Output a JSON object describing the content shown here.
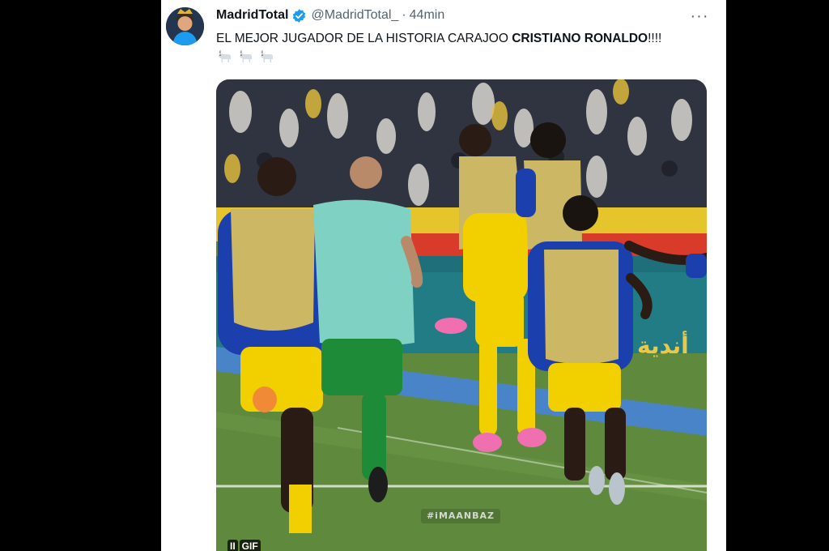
{
  "tweet": {
    "display_name": "MadridTotal",
    "handle": "@MadridTotal_",
    "separator": "·",
    "time": "44min",
    "more_label": "···",
    "text_plain": "EL MEJOR JUGADOR DE LA HISTORIA CARAJOO ",
    "text_bold": "CRISTIANO RONALDO",
    "text_tail": "!!!!",
    "emojis": [
      "goat-emoji",
      "goat-emoji",
      "goat-emoji"
    ],
    "media": {
      "watermark": "#iMAANBAZ",
      "pause_label": "II",
      "gif_label": "GIF",
      "ad_board_text": "أندية"
    }
  },
  "colors": {
    "page_bg": "#000000",
    "card_bg": "#ffffff",
    "verified_blue": "#1d9bf0",
    "secondary_text": "#536471",
    "pitch_green": "#5f8a3e",
    "kit_yellow": "#f2d000",
    "kit_blue": "#1c3fae"
  }
}
